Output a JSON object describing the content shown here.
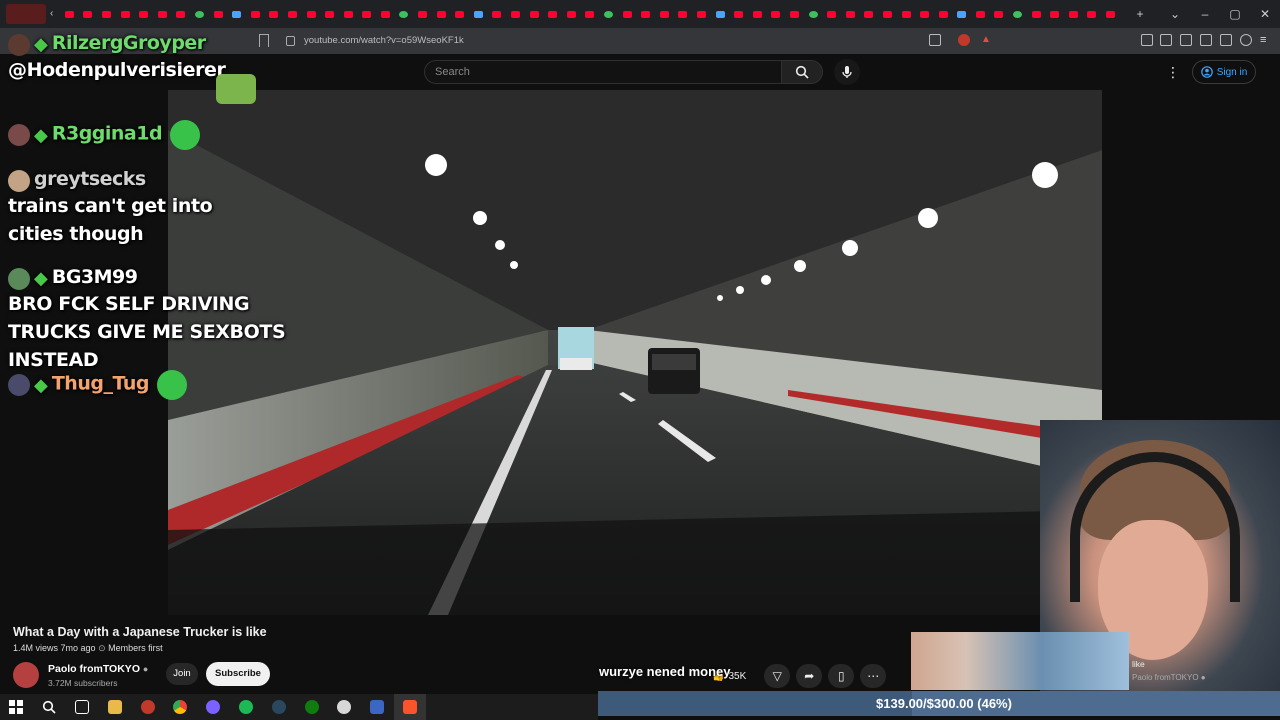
{
  "browser": {
    "url": "youtube.com/watch?v=o59WseoKF1k",
    "tab_count": 57
  },
  "youtube": {
    "search_placeholder": "Search",
    "signin_label": "Sign in",
    "video": {
      "title": "What a Day with a Japanese Trucker is like",
      "views": "1.4M views",
      "age": "7mo ago",
      "members_first": "Members first",
      "channel": "Paolo fromTOKYO",
      "subscribers": "3.72M subscribers",
      "join_label": "Join",
      "subscribe_label": "Subscribe",
      "likes": "35K"
    },
    "recommended": {
      "title": "like",
      "channel": "Paolo fromTOKYO"
    }
  },
  "chat": [
    {
      "user": "RilzergGroyper",
      "message": "@Hodenpulverisierer",
      "user_color": "#6ddc6d"
    },
    {
      "user": "R3ggina1d",
      "message": "",
      "user_color": "#6ddc6d"
    },
    {
      "user": "greytsecks",
      "message": "trains can't get into cities though",
      "user_color": "#d0d0d0"
    },
    {
      "user": "BG3M99",
      "message": "BRO FCK SELF DRIVING TRUCKS GIVE ME SEXBOTS INSTEAD",
      "user_color": "#ffffff"
    },
    {
      "user": "Thug_Tug",
      "message": "",
      "user_color": "#f5a36c"
    }
  ],
  "alert_text": "wurzye nened money",
  "donation_goal": {
    "text": "$139.00/$300.00 (46%)",
    "progress": 0.46
  },
  "colors": {
    "youtube_red": "#ff0033",
    "link_blue": "#3ea6ff",
    "goal_bar": "#4d6c8f"
  }
}
